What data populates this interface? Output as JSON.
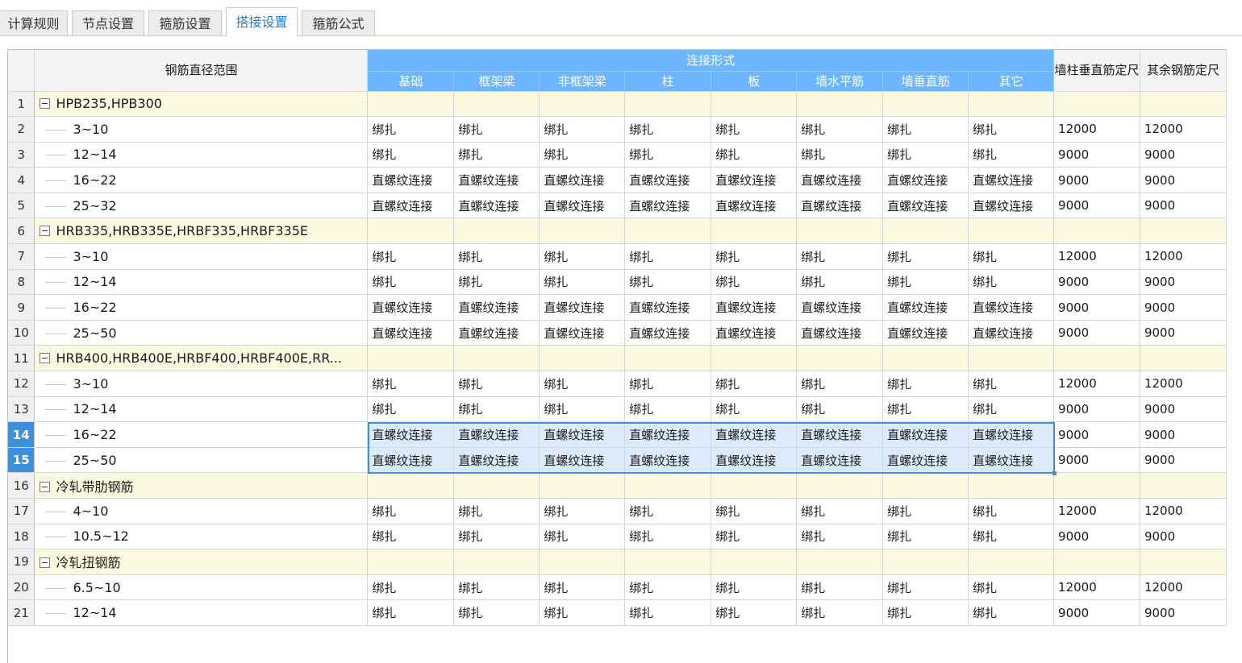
{
  "tabs": [
    {
      "label": "计算规则",
      "active": false
    },
    {
      "label": "节点设置",
      "active": false
    },
    {
      "label": "箍筋设置",
      "active": false
    },
    {
      "label": "搭接设置",
      "active": true
    },
    {
      "label": "箍筋公式",
      "active": false
    }
  ],
  "header": {
    "diameter_range": "钢筋直径范围",
    "connection_type": "连接形式",
    "sub_columns": [
      "基础",
      "框架梁",
      "非框架梁",
      "柱",
      "板",
      "墙水平筋",
      "墙垂直筋",
      "其它"
    ],
    "wall_column_length": "墙柱垂直筋定尺",
    "other_length": "其余钢筋定尺"
  },
  "rows": [
    {
      "num": "1",
      "type": "group",
      "name": "HPB235,HPB300"
    },
    {
      "num": "2",
      "type": "item",
      "name": "3~10",
      "cells": [
        "绑扎",
        "绑扎",
        "绑扎",
        "绑扎",
        "绑扎",
        "绑扎",
        "绑扎",
        "绑扎"
      ],
      "len1": "12000",
      "len2": "12000"
    },
    {
      "num": "3",
      "type": "item",
      "name": "12~14",
      "cells": [
        "绑扎",
        "绑扎",
        "绑扎",
        "绑扎",
        "绑扎",
        "绑扎",
        "绑扎",
        "绑扎"
      ],
      "len1": "9000",
      "len2": "9000"
    },
    {
      "num": "4",
      "type": "item",
      "name": "16~22",
      "cells": [
        "直螺纹连接",
        "直螺纹连接",
        "直螺纹连接",
        "直螺纹连接",
        "直螺纹连接",
        "直螺纹连接",
        "直螺纹连接",
        "直螺纹连接"
      ],
      "len1": "9000",
      "len2": "9000"
    },
    {
      "num": "5",
      "type": "item",
      "name": "25~32",
      "cells": [
        "直螺纹连接",
        "直螺纹连接",
        "直螺纹连接",
        "直螺纹连接",
        "直螺纹连接",
        "直螺纹连接",
        "直螺纹连接",
        "直螺纹连接"
      ],
      "len1": "9000",
      "len2": "9000"
    },
    {
      "num": "6",
      "type": "group",
      "name": "HRB335,HRB335E,HRBF335,HRBF335E"
    },
    {
      "num": "7",
      "type": "item",
      "name": "3~10",
      "cells": [
        "绑扎",
        "绑扎",
        "绑扎",
        "绑扎",
        "绑扎",
        "绑扎",
        "绑扎",
        "绑扎"
      ],
      "len1": "12000",
      "len2": "12000"
    },
    {
      "num": "8",
      "type": "item",
      "name": "12~14",
      "cells": [
        "绑扎",
        "绑扎",
        "绑扎",
        "绑扎",
        "绑扎",
        "绑扎",
        "绑扎",
        "绑扎"
      ],
      "len1": "9000",
      "len2": "9000"
    },
    {
      "num": "9",
      "type": "item",
      "name": "16~22",
      "cells": [
        "直螺纹连接",
        "直螺纹连接",
        "直螺纹连接",
        "直螺纹连接",
        "直螺纹连接",
        "直螺纹连接",
        "直螺纹连接",
        "直螺纹连接"
      ],
      "len1": "9000",
      "len2": "9000"
    },
    {
      "num": "10",
      "type": "item",
      "name": "25~50",
      "cells": [
        "直螺纹连接",
        "直螺纹连接",
        "直螺纹连接",
        "直螺纹连接",
        "直螺纹连接",
        "直螺纹连接",
        "直螺纹连接",
        "直螺纹连接"
      ],
      "len1": "9000",
      "len2": "9000"
    },
    {
      "num": "11",
      "type": "group",
      "name": "HRB400,HRB400E,HRBF400,HRBF400E,RR..."
    },
    {
      "num": "12",
      "type": "item",
      "name": "3~10",
      "cells": [
        "绑扎",
        "绑扎",
        "绑扎",
        "绑扎",
        "绑扎",
        "绑扎",
        "绑扎",
        "绑扎"
      ],
      "len1": "12000",
      "len2": "12000"
    },
    {
      "num": "13",
      "type": "item",
      "name": "12~14",
      "cells": [
        "绑扎",
        "绑扎",
        "绑扎",
        "绑扎",
        "绑扎",
        "绑扎",
        "绑扎",
        "绑扎"
      ],
      "len1": "9000",
      "len2": "9000"
    },
    {
      "num": "14",
      "type": "item",
      "selected": true,
      "name": "16~22",
      "cells": [
        "直螺纹连接",
        "直螺纹连接",
        "直螺纹连接",
        "直螺纹连接",
        "直螺纹连接",
        "直螺纹连接",
        "直螺纹连接",
        "直螺纹连接"
      ],
      "len1": "9000",
      "len2": "9000"
    },
    {
      "num": "15",
      "type": "item",
      "selected": true,
      "name": "25~50",
      "cells": [
        "直螺纹连接",
        "直螺纹连接",
        "直螺纹连接",
        "直螺纹连接",
        "直螺纹连接",
        "直螺纹连接",
        "直螺纹连接",
        "直螺纹连接"
      ],
      "len1": "9000",
      "len2": "9000"
    },
    {
      "num": "16",
      "type": "group",
      "name": "冷轧带肋钢筋"
    },
    {
      "num": "17",
      "type": "item",
      "name": "4~10",
      "cells": [
        "绑扎",
        "绑扎",
        "绑扎",
        "绑扎",
        "绑扎",
        "绑扎",
        "绑扎",
        "绑扎"
      ],
      "len1": "12000",
      "len2": "12000"
    },
    {
      "num": "18",
      "type": "item",
      "name": "10.5~12",
      "cells": [
        "绑扎",
        "绑扎",
        "绑扎",
        "绑扎",
        "绑扎",
        "绑扎",
        "绑扎",
        "绑扎"
      ],
      "len1": "9000",
      "len2": "9000"
    },
    {
      "num": "19",
      "type": "group",
      "name": "冷轧扭钢筋"
    },
    {
      "num": "20",
      "type": "item",
      "name": "6.5~10",
      "cells": [
        "绑扎",
        "绑扎",
        "绑扎",
        "绑扎",
        "绑扎",
        "绑扎",
        "绑扎",
        "绑扎"
      ],
      "len1": "12000",
      "len2": "12000"
    },
    {
      "num": "21",
      "type": "item",
      "name": "12~14",
      "cells": [
        "绑扎",
        "绑扎",
        "绑扎",
        "绑扎",
        "绑扎",
        "绑扎",
        "绑扎",
        "绑扎"
      ],
      "len1": "9000",
      "len2": "9000"
    }
  ],
  "colors": {
    "accent": "#3e8fdc",
    "header_blue": "#6cb6ff",
    "group_row": "#fcf9e1",
    "selection_fill": "#dcebfb"
  }
}
